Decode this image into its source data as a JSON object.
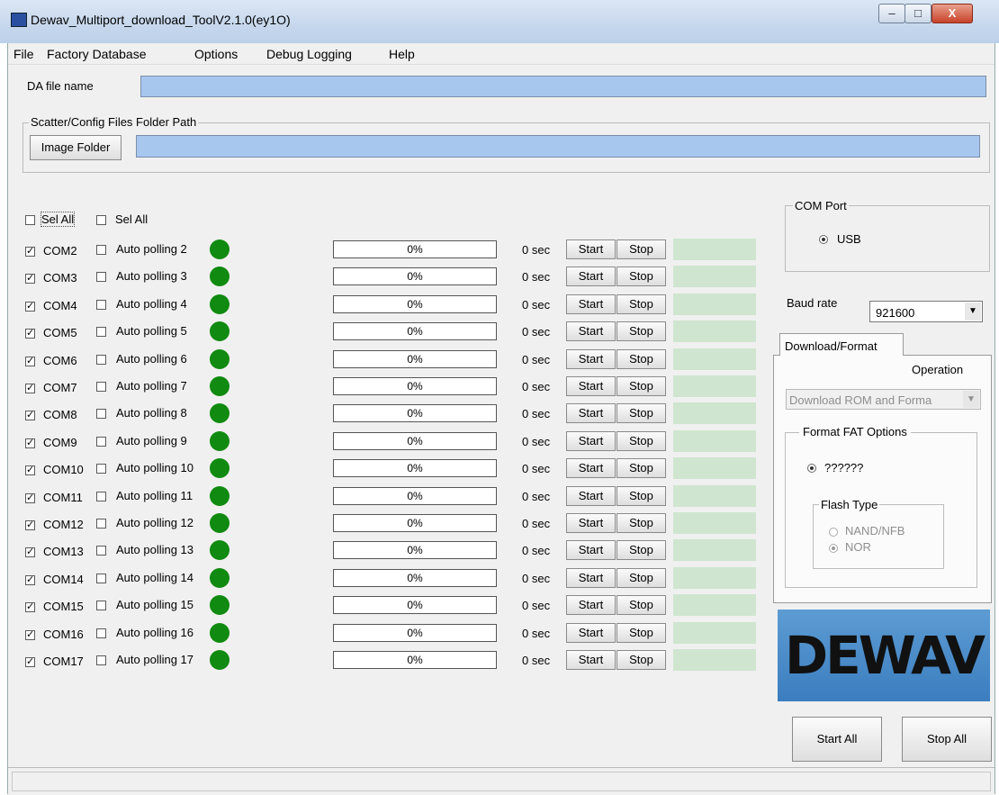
{
  "window": {
    "title": "Dewav_Multiport_download_ToolV2.1.0(ey1O)",
    "minimize": "–",
    "maximize": "□",
    "close": "X"
  },
  "menu": [
    "File",
    "Factory Database",
    "Options",
    "Debug Logging",
    "Help"
  ],
  "da": {
    "label": "DA file name",
    "value": ""
  },
  "scatter": {
    "group_title": "Scatter/Config Files Folder Path",
    "button": "Image Folder",
    "value": ""
  },
  "sel_all": [
    "Sel All",
    "Sel All"
  ],
  "ports": [
    {
      "com": "COM2",
      "polling": "Auto polling 2",
      "progress": "0%",
      "time": "0 sec",
      "checked": true,
      "auto": false
    },
    {
      "com": "COM3",
      "polling": "Auto polling 3",
      "progress": "0%",
      "time": "0 sec",
      "checked": true,
      "auto": false
    },
    {
      "com": "COM4",
      "polling": "Auto polling 4",
      "progress": "0%",
      "time": "0 sec",
      "checked": true,
      "auto": false
    },
    {
      "com": "COM5",
      "polling": "Auto polling 5",
      "progress": "0%",
      "time": "0 sec",
      "checked": true,
      "auto": false
    },
    {
      "com": "COM6",
      "polling": "Auto polling 6",
      "progress": "0%",
      "time": "0 sec",
      "checked": true,
      "auto": false
    },
    {
      "com": "COM7",
      "polling": "Auto polling 7",
      "progress": "0%",
      "time": "0 sec",
      "checked": true,
      "auto": false
    },
    {
      "com": "COM8",
      "polling": "Auto polling 8",
      "progress": "0%",
      "time": "0 sec",
      "checked": true,
      "auto": false
    },
    {
      "com": "COM9",
      "polling": "Auto polling 9",
      "progress": "0%",
      "time": "0 sec",
      "checked": true,
      "auto": false
    },
    {
      "com": "COM10",
      "polling": "Auto polling 10",
      "progress": "0%",
      "time": "0 sec",
      "checked": true,
      "auto": false
    },
    {
      "com": "COM11",
      "polling": "Auto polling 11",
      "progress": "0%",
      "time": "0 sec",
      "checked": true,
      "auto": false
    },
    {
      "com": "COM12",
      "polling": "Auto polling 12",
      "progress": "0%",
      "time": "0 sec",
      "checked": true,
      "auto": false
    },
    {
      "com": "COM13",
      "polling": "Auto polling 13",
      "progress": "0%",
      "time": "0 sec",
      "checked": true,
      "auto": false
    },
    {
      "com": "COM14",
      "polling": "Auto polling 14",
      "progress": "0%",
      "time": "0 sec",
      "checked": true,
      "auto": false
    },
    {
      "com": "COM15",
      "polling": "Auto polling 15",
      "progress": "0%",
      "time": "0 sec",
      "checked": true,
      "auto": false
    },
    {
      "com": "COM16",
      "polling": "Auto polling 16",
      "progress": "0%",
      "time": "0 sec",
      "checked": true,
      "auto": false
    },
    {
      "com": "COM17",
      "polling": "Auto polling 17",
      "progress": "0%",
      "time": "0 sec",
      "checked": true,
      "auto": false
    }
  ],
  "row_buttons": {
    "start": "Start",
    "stop": "Stop"
  },
  "com_port": {
    "title": "COM Port",
    "option": "USB",
    "selected": true
  },
  "baud": {
    "label": "Baud rate",
    "value": "921600"
  },
  "tab": {
    "label": "Download/Format"
  },
  "operation": {
    "label": "Operation",
    "value": "Download ROM and Forma"
  },
  "format_fat": {
    "title": "Format FAT Options",
    "option": "??????",
    "selected": true
  },
  "flash_type": {
    "title": "Flash  Type",
    "options": [
      {
        "label": "NAND/NFB",
        "selected": false
      },
      {
        "label": "NOR",
        "selected": true
      }
    ]
  },
  "logo": {
    "text": "DEWAV"
  },
  "actions": {
    "start_all": "Start All",
    "stop_all": "Stop All"
  },
  "colors": {
    "led": "#108a10",
    "field": "#a7c7ef",
    "status_cell": "#cfe5cf",
    "logo_bg": "#4a8ccb"
  }
}
